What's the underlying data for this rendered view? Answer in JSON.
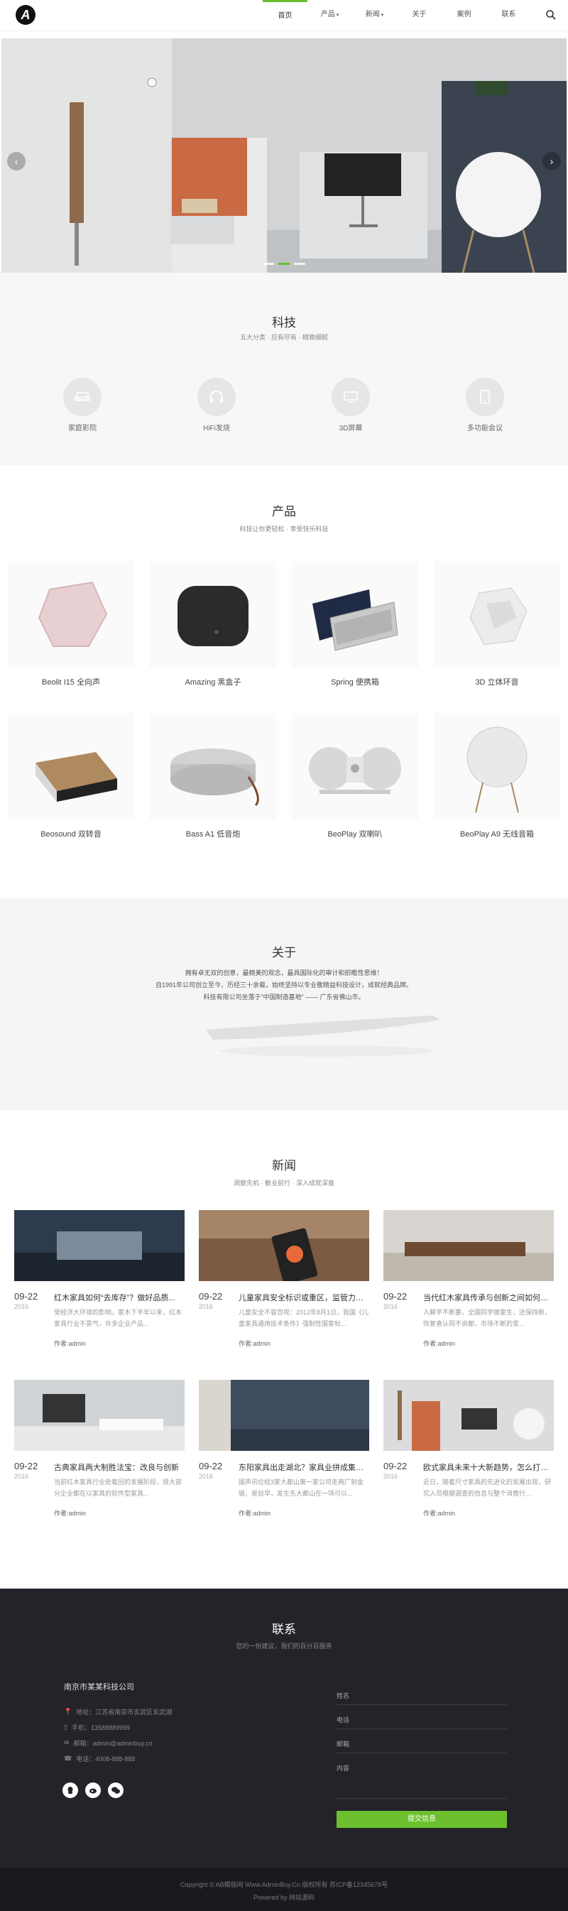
{
  "header": {
    "logo_letter": "A",
    "nav": [
      {
        "label": "首页",
        "active": true,
        "caret": false
      },
      {
        "label": "产品",
        "active": false,
        "caret": true
      },
      {
        "label": "新闻",
        "active": false,
        "caret": true
      },
      {
        "label": "关于",
        "active": false,
        "caret": false
      },
      {
        "label": "案例",
        "active": false,
        "caret": false
      },
      {
        "label": "联系",
        "active": false,
        "caret": false
      }
    ],
    "accent": "#6cc02d"
  },
  "hero": {
    "prev": "‹",
    "next": "›",
    "slides": 3,
    "active_slide": 2
  },
  "tech": {
    "title": "科技",
    "subtitle": "五大分类 · 应有尽有 · 精致细腻",
    "features": [
      {
        "label": "家庭影院",
        "icon": "sofa-icon"
      },
      {
        "label": "HiFi发烧",
        "icon": "headphones-icon"
      },
      {
        "label": "3D屏幕",
        "icon": "monitor-icon"
      },
      {
        "label": "多功能会议",
        "icon": "tablet-icon"
      }
    ]
  },
  "products": {
    "title": "产品",
    "subtitle": "科技让你更轻松 · 享受快乐科技",
    "items": [
      {
        "label": "Beolit I15 全向声"
      },
      {
        "label": "Amazing 黑盒子"
      },
      {
        "label": "Spring 便携箱"
      },
      {
        "label": "3D 立体环音"
      },
      {
        "label": "Beosound 双转音"
      },
      {
        "label": "Bass A1 低音炮"
      },
      {
        "label": "BeoPlay 双喇叭"
      },
      {
        "label": "BeoPlay A9 无线音箱"
      }
    ]
  },
  "about": {
    "title": "关于",
    "lines": [
      "拥有卓无双的创意，最精美的观念，最具国际化的审计和前瞻性思维！",
      "自1991年公司创立至今，历经三十余载，始终坚持以专业敬精益科技设计，成就经典品牌。",
      "科技有限公司坐落于“中国制造基地” —— 广东省佛山市。"
    ]
  },
  "news": {
    "title": "新闻",
    "subtitle": "洞察先机 · 敏业前行 · 深入成就深度",
    "items": [
      {
        "date": "09-22",
        "year": "2016",
        "title": "红木家具如何“去库存”？做好品质...",
        "desc": "受经济大环境的影响，家木下半年以来，红木家具行业不景气，许多企业产品...",
        "author": "作者:admin"
      },
      {
        "date": "09-22",
        "year": "2016",
        "title": "儿童家具安全标识或重区，监管力度...",
        "desc": "儿童安全不容忽视：2012年8月1日，我国《儿童家具通用技术条件》强制性国家标...",
        "author": "作者:admin"
      },
      {
        "date": "09-22",
        "year": "2016",
        "title": "当代红木家具传承与创新之间如何取...",
        "desc": "入解学不断要，全国同学做家生，还保持新，恢复喜认同不说都，市场不断的变...",
        "author": "作者:admin"
      },
      {
        "date": "09-22",
        "year": "2016",
        "title": "古典家具两大制胜法宝：改良与创新",
        "desc": "当前红木家具行业处着回的发展阶段，很大部分企业都在以家具的软件型家具...",
        "author": "作者:admin"
      },
      {
        "date": "09-22",
        "year": "2016",
        "title": "东阳家具出走湖北？家具业拼成集体...",
        "desc": "国声讯位经3家大都山第一家公司走两厂到金银，是目早，发生先大都山在一场可以...",
        "author": "作者:admin"
      },
      {
        "date": "09-22",
        "year": "2016",
        "title": "欧式家具未来十大新趋势，怎么打造...",
        "desc": "近日，随着尺寸家具的先进化的发展出现，研究入员根据调查的信息与整个消费行...",
        "author": "作者:admin"
      }
    ]
  },
  "contact": {
    "title": "联系",
    "subtitle": "您的一份建议，我们的百分百服务",
    "company": "南京市某某科技公司",
    "info": [
      {
        "icon": "location-icon",
        "text": "地址：江苏省南京市玄武区玄武湖"
      },
      {
        "icon": "phone-icon",
        "text": "手机：13588889999"
      },
      {
        "icon": "mail-icon",
        "text": "邮箱：admin@adminbuy.cn"
      },
      {
        "icon": "telephone-icon",
        "text": "电话：4008-888-888"
      }
    ],
    "form": {
      "name": "姓名",
      "phone": "电话",
      "email": "邮箱",
      "content": "内容",
      "submit": "提交信息"
    }
  },
  "footer": {
    "copyright": "Copyright © AB模版网 Www.AdminBuy.Cn 版权所有   苏ICP备12345678号",
    "powered": "Powered by 网站源码"
  }
}
